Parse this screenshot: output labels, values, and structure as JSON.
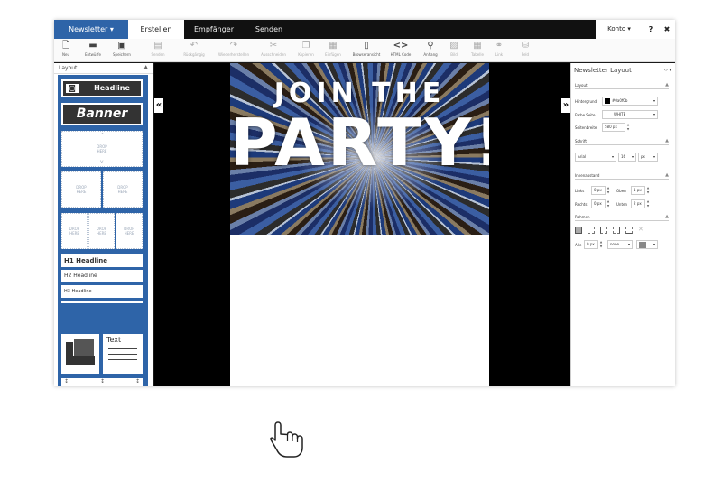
{
  "nav": {
    "newsletter": "Newsletter ▾",
    "erstellen": "Erstellen",
    "empfaenger": "Empfänger",
    "senden": "Senden",
    "konto": "Konto ▾",
    "help": "?",
    "close": "✖"
  },
  "toolbar": [
    {
      "label": "Neu",
      "icon": "new-doc-icon"
    },
    {
      "label": "Entwürfe",
      "icon": "folder-icon"
    },
    {
      "label": "Speichern",
      "icon": "save-icon"
    },
    {
      "label": "Senden",
      "icon": "send-icon"
    },
    {
      "label": "Rückgängig",
      "icon": "undo-icon"
    },
    {
      "label": "Wiederherstellen",
      "icon": "redo-icon"
    },
    {
      "label": "Ausschneiden",
      "icon": "cut-icon"
    },
    {
      "label": "Kopieren",
      "icon": "copy-icon"
    },
    {
      "label": "Einfügen",
      "icon": "paste-icon"
    },
    {
      "label": "Browseransicht",
      "icon": "browser-icon"
    },
    {
      "label": "HTML Code",
      "icon": "code-icon"
    },
    {
      "label": "Anhang",
      "icon": "attachment-icon"
    },
    {
      "label": "Bild",
      "icon": "image-icon"
    },
    {
      "label": "Tabelle",
      "icon": "table-icon"
    },
    {
      "label": "Link",
      "icon": "link-icon"
    },
    {
      "label": "Feld",
      "icon": "database-icon"
    }
  ],
  "left_panel": {
    "title": "Layout",
    "headline_block": "Headline",
    "banner_block": "Banner",
    "drop_text": "DROP\nHERE",
    "h1": "H1 Headline",
    "h2": "H2 Headline",
    "h3": "H3 Headline",
    "text_block": "Text"
  },
  "hero": {
    "line1": "JOIN THE",
    "line2": "PARTY!"
  },
  "right_panel": {
    "title": "Newsletter Layout",
    "sections": {
      "layout": "Layout",
      "schrift": "Schrift",
      "innenabstand": "Innenabstand",
      "rahmen": "Rahmen"
    },
    "fields": {
      "hintergrund_label": "Hintergrund",
      "hintergrund_value": "#0a0f0b",
      "farbe_seite_label": "Farbe Seite",
      "farbe_seite_value": "WHITE",
      "seitenbreite_label": "Seitenbreite",
      "seitenbreite_value": "580 px",
      "font_value": "Arial",
      "font_size_value": "16",
      "font_unit_value": "px",
      "links_label": "Links",
      "links_value": "0 px",
      "oben_label": "Oben",
      "oben_value": "1 px",
      "rechts_label": "Rechts",
      "rechts_value": "0 px",
      "unten_label": "Unten",
      "unten_value": "2 px",
      "alle_label": "Alle",
      "alle_value": "0 px",
      "border_style_value": "none"
    }
  },
  "colors": {
    "nav_bg": "#111111",
    "accent": "#2e64a8",
    "canvas_bg": "#000000"
  }
}
